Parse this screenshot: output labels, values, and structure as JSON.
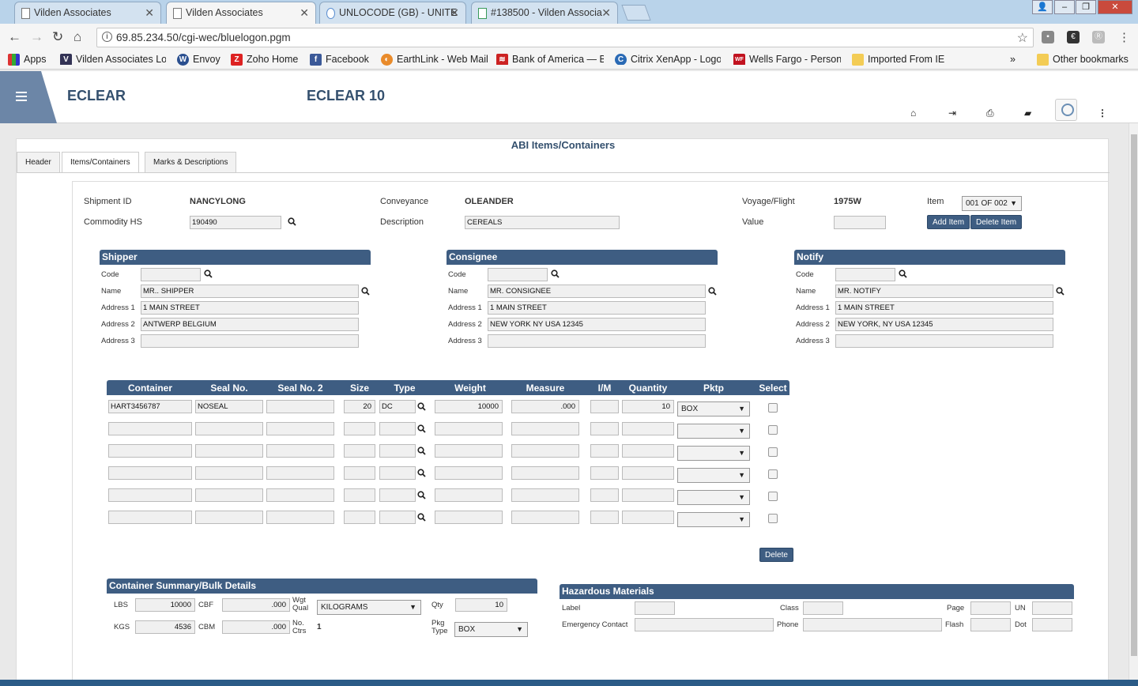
{
  "browser": {
    "tabs": [
      {
        "title": "Vilden Associates"
      },
      {
        "title": "Vilden Associates"
      },
      {
        "title": "UNLOCODE (GB) - UNITE"
      },
      {
        "title": "#138500 - Vilden Associa"
      }
    ],
    "url": "69.85.234.50/cgi-wec/bluelogon.pgm",
    "bookmarks": [
      "Apps",
      "Vilden Associates Log",
      "Envoy",
      "Zoho Home",
      "Facebook",
      "EarthLink - Web Mail",
      "Bank of America — B",
      "Citrix XenApp - Logo",
      "Wells Fargo - Persona",
      "Imported From IE"
    ],
    "more": "»",
    "other_bookmarks": "Other bookmarks"
  },
  "app": {
    "brand_left": "ECLEAR",
    "brand_right": "ECLEAR 10"
  },
  "page": {
    "title": "ABI Items/Containers",
    "tabs": [
      "Header",
      "Items/Containers",
      "Marks & Descriptions"
    ]
  },
  "item": {
    "shipment_id_label": "Shipment ID",
    "shipment_id": "NANCYLONG",
    "conveyance_label": "Conveyance",
    "conveyance": "OLEANDER",
    "voyage_label": "Voyage/Flight",
    "voyage": "1975W",
    "item_label": "Item",
    "item_value": "001 OF 002",
    "commodity_label": "Commodity HS",
    "commodity": "190490",
    "description_label": "Description",
    "description": "CEREALS",
    "value_label": "Value",
    "value": "",
    "add_item": "Add Item",
    "delete_item": "Delete Item"
  },
  "labels": {
    "code": "Code",
    "name": "Name",
    "address1": "Address 1",
    "address2": "Address 2",
    "address3": "Address 3"
  },
  "shipper": {
    "title": "Shipper",
    "code": "",
    "name": "MR.. SHIPPER",
    "address1": "1 MAIN STREET",
    "address2": "ANTWERP BELGIUM",
    "address3": ""
  },
  "consignee": {
    "title": "Consignee",
    "code": "",
    "name": "MR. CONSIGNEE",
    "address1": "1 MAIN STREET",
    "address2": "NEW YORK NY USA 12345",
    "address3": ""
  },
  "notify": {
    "title": "Notify",
    "code": "",
    "name": "MR. NOTIFY",
    "address1": "1 MAIN STREET",
    "address2": "NEW YORK, NY USA 12345",
    "address3": ""
  },
  "containers": {
    "headers": [
      "Container",
      "Seal No.",
      "Seal No. 2",
      "Size",
      "Type",
      "Weight",
      "Measure",
      "I/M",
      "Quantity",
      "Pktp",
      "Select"
    ],
    "rows": [
      {
        "container": "HART3456787",
        "seal": "NOSEAL",
        "seal2": "",
        "size": "20",
        "type": "DC",
        "weight": "10000",
        "measure": ".000",
        "im": "",
        "quantity": "10",
        "pktp": "BOX"
      },
      {
        "container": "",
        "seal": "",
        "seal2": "",
        "size": "",
        "type": "",
        "weight": "",
        "measure": "",
        "im": "",
        "quantity": "",
        "pktp": ""
      },
      {
        "container": "",
        "seal": "",
        "seal2": "",
        "size": "",
        "type": "",
        "weight": "",
        "measure": "",
        "im": "",
        "quantity": "",
        "pktp": ""
      },
      {
        "container": "",
        "seal": "",
        "seal2": "",
        "size": "",
        "type": "",
        "weight": "",
        "measure": "",
        "im": "",
        "quantity": "",
        "pktp": ""
      },
      {
        "container": "",
        "seal": "",
        "seal2": "",
        "size": "",
        "type": "",
        "weight": "",
        "measure": "",
        "im": "",
        "quantity": "",
        "pktp": ""
      },
      {
        "container": "",
        "seal": "",
        "seal2": "",
        "size": "",
        "type": "",
        "weight": "",
        "measure": "",
        "im": "",
        "quantity": "",
        "pktp": ""
      }
    ],
    "delete": "Delete"
  },
  "summary": {
    "title": "Container Summary/Bulk Details",
    "lbs_label": "LBS",
    "lbs": "10000",
    "cbf_label": "CBF",
    "cbf": ".000",
    "wgt_qual_label": "Wgt Qual",
    "wgt_qual": "KILOGRAMS",
    "qty_label": "Qty",
    "qty": "10",
    "kgs_label": "KGS",
    "kgs": "4536",
    "cbm_label": "CBM",
    "cbm": ".000",
    "no_ctrs_label": "No. Ctrs",
    "no_ctrs": "1",
    "pkg_type_label": "Pkg Type",
    "pkg_type": "BOX"
  },
  "hazmat": {
    "title": "Hazardous Materials",
    "label_label": "Label",
    "class_label": "Class",
    "page_label": "Page",
    "un_label": "UN",
    "emergency_label": "Emergency Contact",
    "phone_label": "Phone",
    "flash_label": "Flash",
    "dot_label": "Dot"
  }
}
